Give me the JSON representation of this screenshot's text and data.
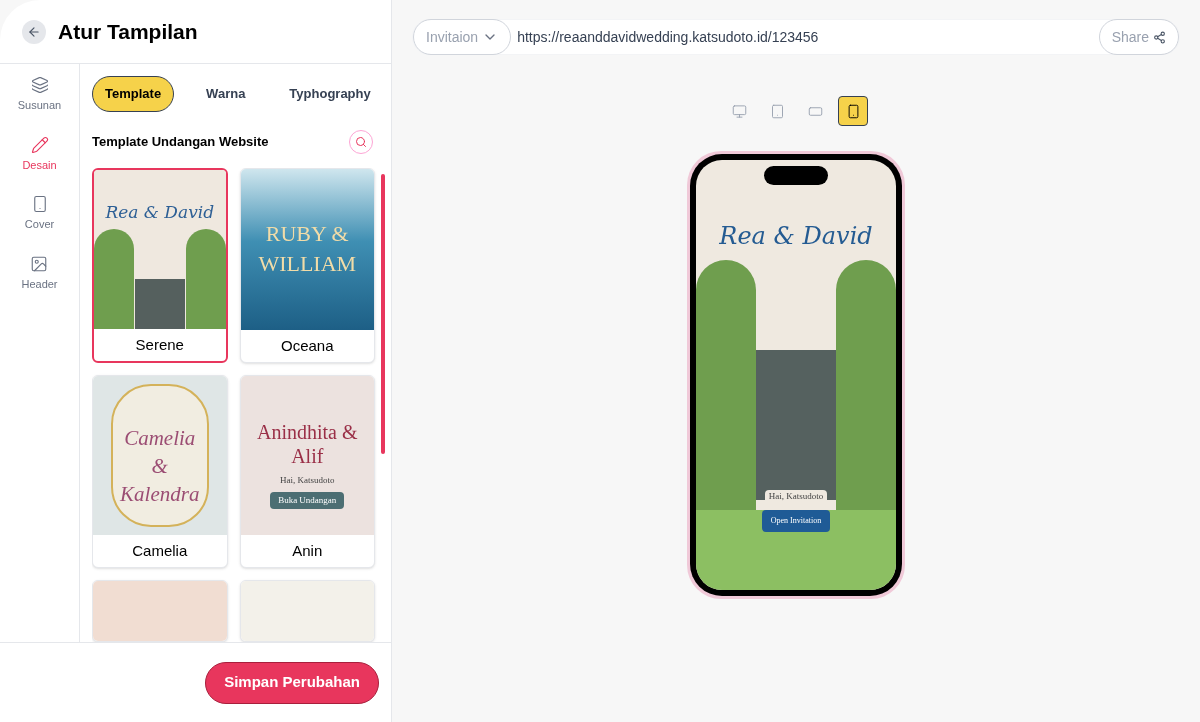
{
  "header": {
    "title": "Atur Tampilan"
  },
  "rail": [
    {
      "kind": "layers",
      "label": "Susunan",
      "selected": false
    },
    {
      "kind": "pencil",
      "label": "Desain",
      "selected": true
    },
    {
      "kind": "phone",
      "label": "Cover",
      "selected": false
    },
    {
      "kind": "image",
      "label": "Header",
      "selected": false
    }
  ],
  "tabs": [
    {
      "label": "Template",
      "selected": true
    },
    {
      "label": "Warna",
      "selected": false
    },
    {
      "label": "Typhography",
      "selected": false
    }
  ],
  "section_title": "Template Undangan Website",
  "templates": [
    {
      "kind": "serene",
      "name": "Serene",
      "title": "Rea & David",
      "selected": true
    },
    {
      "kind": "oceana",
      "name": "Oceana",
      "title": "RUBY & WILLIAM",
      "selected": false
    },
    {
      "kind": "camelia",
      "name": "Camelia",
      "title": "Camelia & Kalendra",
      "selected": false
    },
    {
      "kind": "anin",
      "name": "Anin",
      "title": "Anindhita & Alif",
      "greeting": "Hai, Katsudoto",
      "button": "Buka Undangan",
      "selected": false
    },
    {
      "kind": "partial_rose",
      "selected": false
    },
    {
      "kind": "partial_leaf",
      "selected": false
    }
  ],
  "save_button": "Simpan Perubahan",
  "address_bar": {
    "dropdown": "Invitaion",
    "url": "https://reaanddavidwedding.katsudoto.id/123456",
    "share": "Share"
  },
  "devices": [
    {
      "kind": "desktop",
      "selected": false
    },
    {
      "kind": "tablet",
      "selected": false
    },
    {
      "kind": "landscape",
      "selected": false
    },
    {
      "kind": "mobile",
      "selected": true
    }
  ],
  "preview": {
    "title": "Rea & David",
    "greeting": "Hai, Katsudoto",
    "button": "Open Invitation"
  }
}
